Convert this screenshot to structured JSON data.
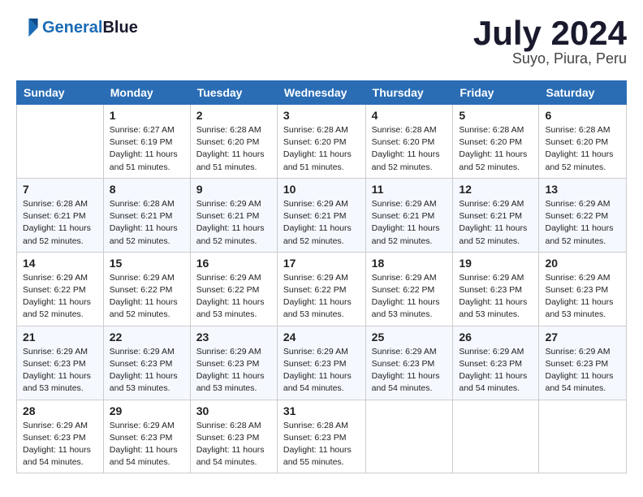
{
  "logo": {
    "line1": "General",
    "line2": "Blue"
  },
  "title": "July 2024",
  "subtitle": "Suyo, Piura, Peru",
  "days_header": [
    "Sunday",
    "Monday",
    "Tuesday",
    "Wednesday",
    "Thursday",
    "Friday",
    "Saturday"
  ],
  "weeks": [
    [
      {
        "day": "",
        "info": ""
      },
      {
        "day": "1",
        "info": "Sunrise: 6:27 AM\nSunset: 6:19 PM\nDaylight: 11 hours\nand 51 minutes."
      },
      {
        "day": "2",
        "info": "Sunrise: 6:28 AM\nSunset: 6:20 PM\nDaylight: 11 hours\nand 51 minutes."
      },
      {
        "day": "3",
        "info": "Sunrise: 6:28 AM\nSunset: 6:20 PM\nDaylight: 11 hours\nand 51 minutes."
      },
      {
        "day": "4",
        "info": "Sunrise: 6:28 AM\nSunset: 6:20 PM\nDaylight: 11 hours\nand 52 minutes."
      },
      {
        "day": "5",
        "info": "Sunrise: 6:28 AM\nSunset: 6:20 PM\nDaylight: 11 hours\nand 52 minutes."
      },
      {
        "day": "6",
        "info": "Sunrise: 6:28 AM\nSunset: 6:20 PM\nDaylight: 11 hours\nand 52 minutes."
      }
    ],
    [
      {
        "day": "7",
        "info": "Sunrise: 6:28 AM\nSunset: 6:21 PM\nDaylight: 11 hours\nand 52 minutes."
      },
      {
        "day": "8",
        "info": "Sunrise: 6:28 AM\nSunset: 6:21 PM\nDaylight: 11 hours\nand 52 minutes."
      },
      {
        "day": "9",
        "info": "Sunrise: 6:29 AM\nSunset: 6:21 PM\nDaylight: 11 hours\nand 52 minutes."
      },
      {
        "day": "10",
        "info": "Sunrise: 6:29 AM\nSunset: 6:21 PM\nDaylight: 11 hours\nand 52 minutes."
      },
      {
        "day": "11",
        "info": "Sunrise: 6:29 AM\nSunset: 6:21 PM\nDaylight: 11 hours\nand 52 minutes."
      },
      {
        "day": "12",
        "info": "Sunrise: 6:29 AM\nSunset: 6:21 PM\nDaylight: 11 hours\nand 52 minutes."
      },
      {
        "day": "13",
        "info": "Sunrise: 6:29 AM\nSunset: 6:22 PM\nDaylight: 11 hours\nand 52 minutes."
      }
    ],
    [
      {
        "day": "14",
        "info": "Sunrise: 6:29 AM\nSunset: 6:22 PM\nDaylight: 11 hours\nand 52 minutes."
      },
      {
        "day": "15",
        "info": "Sunrise: 6:29 AM\nSunset: 6:22 PM\nDaylight: 11 hours\nand 52 minutes."
      },
      {
        "day": "16",
        "info": "Sunrise: 6:29 AM\nSunset: 6:22 PM\nDaylight: 11 hours\nand 53 minutes."
      },
      {
        "day": "17",
        "info": "Sunrise: 6:29 AM\nSunset: 6:22 PM\nDaylight: 11 hours\nand 53 minutes."
      },
      {
        "day": "18",
        "info": "Sunrise: 6:29 AM\nSunset: 6:22 PM\nDaylight: 11 hours\nand 53 minutes."
      },
      {
        "day": "19",
        "info": "Sunrise: 6:29 AM\nSunset: 6:23 PM\nDaylight: 11 hours\nand 53 minutes."
      },
      {
        "day": "20",
        "info": "Sunrise: 6:29 AM\nSunset: 6:23 PM\nDaylight: 11 hours\nand 53 minutes."
      }
    ],
    [
      {
        "day": "21",
        "info": "Sunrise: 6:29 AM\nSunset: 6:23 PM\nDaylight: 11 hours\nand 53 minutes."
      },
      {
        "day": "22",
        "info": "Sunrise: 6:29 AM\nSunset: 6:23 PM\nDaylight: 11 hours\nand 53 minutes."
      },
      {
        "day": "23",
        "info": "Sunrise: 6:29 AM\nSunset: 6:23 PM\nDaylight: 11 hours\nand 53 minutes."
      },
      {
        "day": "24",
        "info": "Sunrise: 6:29 AM\nSunset: 6:23 PM\nDaylight: 11 hours\nand 54 minutes."
      },
      {
        "day": "25",
        "info": "Sunrise: 6:29 AM\nSunset: 6:23 PM\nDaylight: 11 hours\nand 54 minutes."
      },
      {
        "day": "26",
        "info": "Sunrise: 6:29 AM\nSunset: 6:23 PM\nDaylight: 11 hours\nand 54 minutes."
      },
      {
        "day": "27",
        "info": "Sunrise: 6:29 AM\nSunset: 6:23 PM\nDaylight: 11 hours\nand 54 minutes."
      }
    ],
    [
      {
        "day": "28",
        "info": "Sunrise: 6:29 AM\nSunset: 6:23 PM\nDaylight: 11 hours\nand 54 minutes."
      },
      {
        "day": "29",
        "info": "Sunrise: 6:29 AM\nSunset: 6:23 PM\nDaylight: 11 hours\nand 54 minutes."
      },
      {
        "day": "30",
        "info": "Sunrise: 6:28 AM\nSunset: 6:23 PM\nDaylight: 11 hours\nand 54 minutes."
      },
      {
        "day": "31",
        "info": "Sunrise: 6:28 AM\nSunset: 6:23 PM\nDaylight: 11 hours\nand 55 minutes."
      },
      {
        "day": "",
        "info": ""
      },
      {
        "day": "",
        "info": ""
      },
      {
        "day": "",
        "info": ""
      }
    ]
  ]
}
